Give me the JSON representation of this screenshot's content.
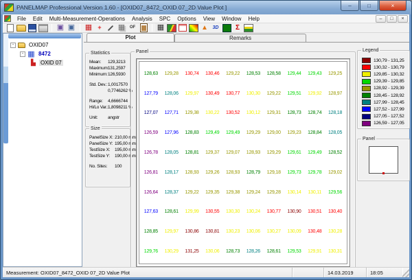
{
  "window": {
    "title": "PANELMAP  Professional Version 1.60 - [OXID07_8472_OXID 07_2D Value Plot ]",
    "controls": {
      "minimize": "–",
      "maximize": "□",
      "close": "×"
    },
    "mdi_controls": {
      "minimize": "–",
      "restore": "□",
      "close": "×"
    }
  },
  "menu": {
    "items": [
      "File",
      "Edit",
      "Multi-Measurement-Operations",
      "Analysis",
      "SPC",
      "Options",
      "View",
      "Window",
      "Help"
    ]
  },
  "toolbar": {
    "groups": [
      {
        "icons": [
          "new-file",
          "open-folder",
          "save",
          "print"
        ]
      },
      {
        "icons": [
          "copy-panel",
          "paste-panel"
        ]
      },
      {
        "icons": [
          "edit-grid",
          "align-points",
          "sign-pen",
          "duplicate-panel",
          "offset-of",
          "clipboard"
        ]
      },
      {
        "icons": [
          "value-table",
          "map-2d",
          "mini-table",
          "color-map",
          "histogram-flame",
          "plot-3d",
          "value-plot-2d",
          "sigma-spc",
          "histogram-bars"
        ]
      }
    ]
  },
  "toolbar_text": {
    "offset-of": "OF",
    "plot-3d": "3D"
  },
  "tree": {
    "items": [
      {
        "label": "OXID07",
        "icon": "folder",
        "level": 0,
        "expandable": true
      },
      {
        "label": "8472",
        "icon": "grid",
        "level": 1,
        "expandable": true
      },
      {
        "label": "OXID 07",
        "icon": "chart",
        "level": 2,
        "expandable": false,
        "selected": true
      }
    ]
  },
  "tabs": [
    {
      "label": "Plot",
      "active": true
    },
    {
      "label": "Remarks",
      "active": false
    }
  ],
  "statistics": {
    "title": "Statistics",
    "rows": [
      {
        "label": "Mean:",
        "value": "129,3213"
      },
      {
        "label": "Maximum:",
        "value": "131,2597"
      },
      {
        "label": "Minimum:",
        "value": "126,5930",
        "gap_after": true
      },
      {
        "label": "Std. Dev.:",
        "value": "1,0017570"
      },
      {
        "label": "",
        "value": "0,7746262 %",
        "gap_after": true
      },
      {
        "label": "Range:",
        "value": "4,6666744"
      },
      {
        "label": "Hi/Lo Var.:",
        "value": "1,8098211 %",
        "gap_after": true
      },
      {
        "label": "Unit:",
        "value": "angstr"
      }
    ]
  },
  "size": {
    "title": "Size",
    "rows": [
      {
        "label": "PanelSize X:",
        "value": "210,00 mm"
      },
      {
        "label": "PanelSize Y:",
        "value": "195,00 mm"
      },
      {
        "label": "TestSize X:",
        "value": "195,00 mm"
      },
      {
        "label": "TestSize Y:",
        "value": "190,00 mm",
        "gap_after": true
      },
      {
        "label": "No. Sites:",
        "value": "100"
      }
    ]
  },
  "panel_plot": {
    "title": "Panel"
  },
  "legend": {
    "title": "Legend",
    "entries": [
      {
        "label": "130,79 - 131,25",
        "color": "#8B0000",
        "low": 130.79
      },
      {
        "label": "130,32 - 130,79",
        "color": "#FF0000",
        "low": 130.32
      },
      {
        "label": "129,85 - 130,32",
        "color": "#F0F000",
        "low": 129.85
      },
      {
        "label": "129,39 - 129,85",
        "color": "#00D800",
        "low": 129.39
      },
      {
        "label": "128,92 - 129,39",
        "color": "#989800",
        "low": 128.92
      },
      {
        "label": "128,45 - 128,92",
        "color": "#008000",
        "low": 128.45
      },
      {
        "label": "127,99 - 128,45",
        "color": "#008080",
        "low": 127.99
      },
      {
        "label": "127,52 - 127,99",
        "color": "#0000FF",
        "low": 127.52
      },
      {
        "label": "127,05 - 127,52",
        "color": "#000080",
        "low": 127.05
      },
      {
        "label": "126,59 - 127,05",
        "color": "#800080",
        "low": 126.59
      }
    ]
  },
  "panel_preview": {
    "title": "Panel"
  },
  "statusbar": {
    "measurement": "Measurement: OXID07_8472_OXID 07_2D Value Plot",
    "date": "14.03.2019",
    "time": "18:05"
  },
  "chart_data": {
    "type": "heatmap",
    "title": "OXID07_8472_OXID 07_2D Value Plot",
    "unit": "angstr",
    "rows": 10,
    "cols": 10,
    "values": [
      [
        128.63,
        129.28,
        130.74,
        130.46,
        129.22,
        128.53,
        128.58,
        129.44,
        129.43,
        129.25
      ],
      [
        127.79,
        128.06,
        129.97,
        130.49,
        130.77,
        130.3,
        129.22,
        129.51,
        129.92,
        128.97
      ],
      [
        127.07,
        127.71,
        129.38,
        130.22,
        130.52,
        130.12,
        129.31,
        128.73,
        128.74,
        128.18
      ],
      [
        126.59,
        127.96,
        128.83,
        129.49,
        129.49,
        129.29,
        129.0,
        129.23,
        128.84,
        128.05
      ],
      [
        126.78,
        128.05,
        128.81,
        129.37,
        129.07,
        128.93,
        129.29,
        129.61,
        129.49,
        128.52
      ],
      [
        126.81,
        128.17,
        128.93,
        129.26,
        128.93,
        128.79,
        129.18,
        129.73,
        129.78,
        129.02
      ],
      [
        126.64,
        128.37,
        129.22,
        129.35,
        129.38,
        129.24,
        129.28,
        130.14,
        130.11,
        129.56
      ],
      [
        127.63,
        128.61,
        129.99,
        130.55,
        130.3,
        130.24,
        130.77,
        130.9,
        130.51,
        130.4
      ],
      [
        128.85,
        129.97,
        130.86,
        130.81,
        130.23,
        130.06,
        130.27,
        130.09,
        130.48,
        130.28
      ],
      [
        129.76,
        130.29,
        131.25,
        130.06,
        128.73,
        128.26,
        128.61,
        129.53,
        129.91,
        130.31
      ]
    ]
  }
}
